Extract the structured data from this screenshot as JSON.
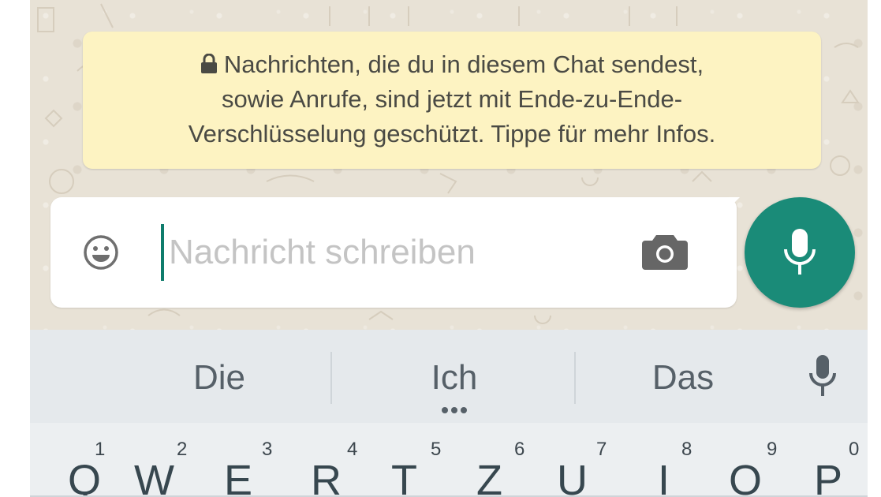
{
  "notice": {
    "line1": "Nachrichten, die du in diesem Chat sendest,",
    "line2": "sowie Anrufe, sind jetzt mit Ende-zu-Ende-",
    "line3": "Verschlüsselung geschützt. Tippe für mehr Infos.",
    "icon": "lock-icon"
  },
  "composer": {
    "placeholder": "Nachricht schreiben",
    "value": "",
    "emoji_icon": "emoji-icon",
    "camera_icon": "camera-icon",
    "send_icon": "microphone-icon"
  },
  "suggestions": [
    "Die",
    "Ich",
    "Das"
  ],
  "keyboard": {
    "keys": [
      {
        "letter": "Q",
        "hint": "1"
      },
      {
        "letter": "W",
        "hint": "2"
      },
      {
        "letter": "E",
        "hint": "3"
      },
      {
        "letter": "R",
        "hint": "4"
      },
      {
        "letter": "T",
        "hint": "5"
      },
      {
        "letter": "Z",
        "hint": "6"
      },
      {
        "letter": "U",
        "hint": "7"
      },
      {
        "letter": "I",
        "hint": "8"
      },
      {
        "letter": "O",
        "hint": "9"
      },
      {
        "letter": "P",
        "hint": "0"
      }
    ]
  },
  "colors": {
    "accent": "#1a8b78",
    "notice_bg": "#fdf3c2",
    "keyboard_bg": "#eceff1"
  }
}
